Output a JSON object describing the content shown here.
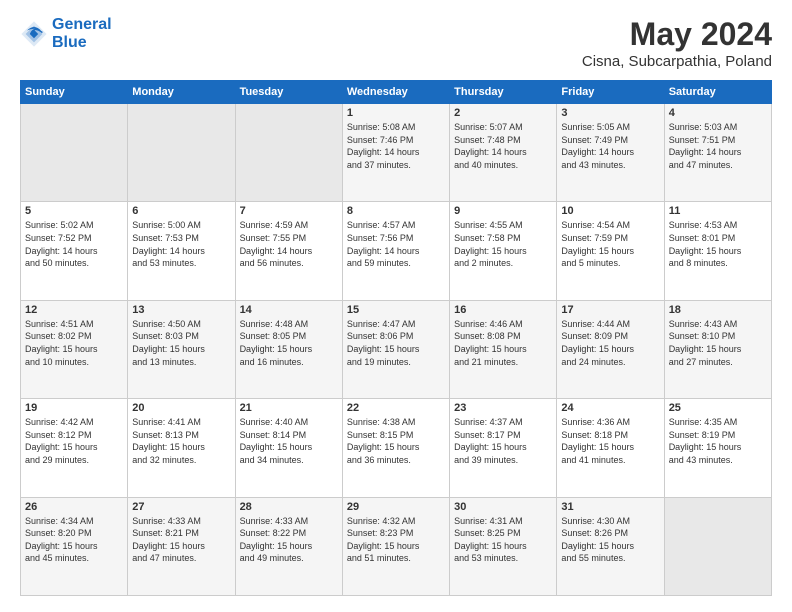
{
  "header": {
    "logo_line1": "General",
    "logo_line2": "Blue",
    "month": "May 2024",
    "location": "Cisna, Subcarpathia, Poland"
  },
  "weekdays": [
    "Sunday",
    "Monday",
    "Tuesday",
    "Wednesday",
    "Thursday",
    "Friday",
    "Saturday"
  ],
  "weeks": [
    [
      {
        "day": "",
        "info": ""
      },
      {
        "day": "",
        "info": ""
      },
      {
        "day": "",
        "info": ""
      },
      {
        "day": "1",
        "info": "Sunrise: 5:08 AM\nSunset: 7:46 PM\nDaylight: 14 hours\nand 37 minutes."
      },
      {
        "day": "2",
        "info": "Sunrise: 5:07 AM\nSunset: 7:48 PM\nDaylight: 14 hours\nand 40 minutes."
      },
      {
        "day": "3",
        "info": "Sunrise: 5:05 AM\nSunset: 7:49 PM\nDaylight: 14 hours\nand 43 minutes."
      },
      {
        "day": "4",
        "info": "Sunrise: 5:03 AM\nSunset: 7:51 PM\nDaylight: 14 hours\nand 47 minutes."
      }
    ],
    [
      {
        "day": "5",
        "info": "Sunrise: 5:02 AM\nSunset: 7:52 PM\nDaylight: 14 hours\nand 50 minutes."
      },
      {
        "day": "6",
        "info": "Sunrise: 5:00 AM\nSunset: 7:53 PM\nDaylight: 14 hours\nand 53 minutes."
      },
      {
        "day": "7",
        "info": "Sunrise: 4:59 AM\nSunset: 7:55 PM\nDaylight: 14 hours\nand 56 minutes."
      },
      {
        "day": "8",
        "info": "Sunrise: 4:57 AM\nSunset: 7:56 PM\nDaylight: 14 hours\nand 59 minutes."
      },
      {
        "day": "9",
        "info": "Sunrise: 4:55 AM\nSunset: 7:58 PM\nDaylight: 15 hours\nand 2 minutes."
      },
      {
        "day": "10",
        "info": "Sunrise: 4:54 AM\nSunset: 7:59 PM\nDaylight: 15 hours\nand 5 minutes."
      },
      {
        "day": "11",
        "info": "Sunrise: 4:53 AM\nSunset: 8:01 PM\nDaylight: 15 hours\nand 8 minutes."
      }
    ],
    [
      {
        "day": "12",
        "info": "Sunrise: 4:51 AM\nSunset: 8:02 PM\nDaylight: 15 hours\nand 10 minutes."
      },
      {
        "day": "13",
        "info": "Sunrise: 4:50 AM\nSunset: 8:03 PM\nDaylight: 15 hours\nand 13 minutes."
      },
      {
        "day": "14",
        "info": "Sunrise: 4:48 AM\nSunset: 8:05 PM\nDaylight: 15 hours\nand 16 minutes."
      },
      {
        "day": "15",
        "info": "Sunrise: 4:47 AM\nSunset: 8:06 PM\nDaylight: 15 hours\nand 19 minutes."
      },
      {
        "day": "16",
        "info": "Sunrise: 4:46 AM\nSunset: 8:08 PM\nDaylight: 15 hours\nand 21 minutes."
      },
      {
        "day": "17",
        "info": "Sunrise: 4:44 AM\nSunset: 8:09 PM\nDaylight: 15 hours\nand 24 minutes."
      },
      {
        "day": "18",
        "info": "Sunrise: 4:43 AM\nSunset: 8:10 PM\nDaylight: 15 hours\nand 27 minutes."
      }
    ],
    [
      {
        "day": "19",
        "info": "Sunrise: 4:42 AM\nSunset: 8:12 PM\nDaylight: 15 hours\nand 29 minutes."
      },
      {
        "day": "20",
        "info": "Sunrise: 4:41 AM\nSunset: 8:13 PM\nDaylight: 15 hours\nand 32 minutes."
      },
      {
        "day": "21",
        "info": "Sunrise: 4:40 AM\nSunset: 8:14 PM\nDaylight: 15 hours\nand 34 minutes."
      },
      {
        "day": "22",
        "info": "Sunrise: 4:38 AM\nSunset: 8:15 PM\nDaylight: 15 hours\nand 36 minutes."
      },
      {
        "day": "23",
        "info": "Sunrise: 4:37 AM\nSunset: 8:17 PM\nDaylight: 15 hours\nand 39 minutes."
      },
      {
        "day": "24",
        "info": "Sunrise: 4:36 AM\nSunset: 8:18 PM\nDaylight: 15 hours\nand 41 minutes."
      },
      {
        "day": "25",
        "info": "Sunrise: 4:35 AM\nSunset: 8:19 PM\nDaylight: 15 hours\nand 43 minutes."
      }
    ],
    [
      {
        "day": "26",
        "info": "Sunrise: 4:34 AM\nSunset: 8:20 PM\nDaylight: 15 hours\nand 45 minutes."
      },
      {
        "day": "27",
        "info": "Sunrise: 4:33 AM\nSunset: 8:21 PM\nDaylight: 15 hours\nand 47 minutes."
      },
      {
        "day": "28",
        "info": "Sunrise: 4:33 AM\nSunset: 8:22 PM\nDaylight: 15 hours\nand 49 minutes."
      },
      {
        "day": "29",
        "info": "Sunrise: 4:32 AM\nSunset: 8:23 PM\nDaylight: 15 hours\nand 51 minutes."
      },
      {
        "day": "30",
        "info": "Sunrise: 4:31 AM\nSunset: 8:25 PM\nDaylight: 15 hours\nand 53 minutes."
      },
      {
        "day": "31",
        "info": "Sunrise: 4:30 AM\nSunset: 8:26 PM\nDaylight: 15 hours\nand 55 minutes."
      },
      {
        "day": "",
        "info": ""
      }
    ]
  ]
}
